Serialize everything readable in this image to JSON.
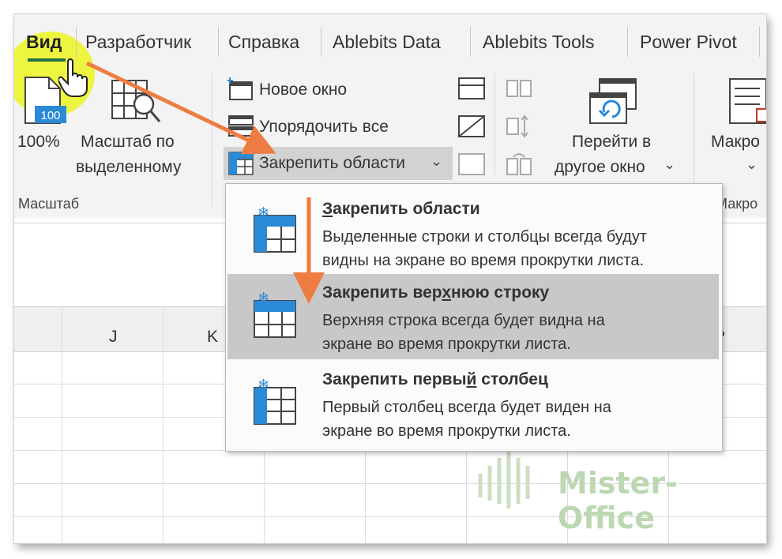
{
  "tabs": [
    {
      "label": "Вид",
      "active": true
    },
    {
      "label": "Разработчик"
    },
    {
      "label": "Справка"
    },
    {
      "label": "Ablebits Data"
    },
    {
      "label": "Ablebits Tools"
    },
    {
      "label": "Power Pivot"
    }
  ],
  "ribbon": {
    "zoom_group": {
      "zoom100_label": "100%",
      "zoom100_icon_text": "100",
      "zoom_selection_line1": "Масштаб по",
      "zoom_selection_line2": "выделенному",
      "group_label": "Масштаб"
    },
    "window_group": {
      "new_window": "Новое окно",
      "arrange_all": "Упорядочить все",
      "freeze_panes": "Закрепить области",
      "switch_window_line1": "Перейти в",
      "switch_window_line2": "другое окно"
    },
    "macros_group": {
      "macros_label": "Макро",
      "group_label": "Макро"
    }
  },
  "sheet": {
    "column_letters": [
      "J",
      "K",
      "P"
    ]
  },
  "dropdown": {
    "items": [
      {
        "title_pre": "",
        "title_u": "З",
        "title_post": "акрепить области",
        "desc_line1": "Выделенные строки и столбцы всегда будут",
        "desc_line2": "видны на экране во время прокрутки листа."
      },
      {
        "title_pre": "Закрепить вер",
        "title_u": "х",
        "title_post": "нюю строку",
        "desc_line1": "Верхняя строка всегда будет видна на",
        "desc_line2": "экране во время прокрутки листа."
      },
      {
        "title_pre": "Закрепить первы",
        "title_u": "й",
        "title_post": " столбец",
        "desc_line1": "Первый столбец всегда будет виден на",
        "desc_line2": "экране во время прокрутки листа."
      }
    ]
  },
  "watermark": {
    "text": "Mister-Office"
  },
  "colors": {
    "accent_green": "#217346",
    "arrow_orange": "#ee7d43",
    "highlight_yellow": "#eef532",
    "icon_blue": "#2b8ad6"
  }
}
